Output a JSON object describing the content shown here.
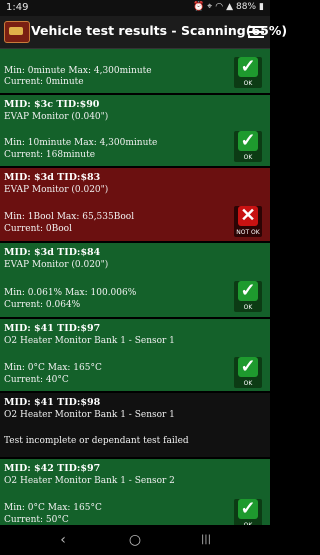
{
  "status": {
    "time": "1:49",
    "battery": "88%"
  },
  "app": {
    "title": "Vehicle test results - Scanning(65%)"
  },
  "results": [
    {
      "status": "ok",
      "status_label": "OK",
      "range": "Min: 0minute  Max: 4,300minute",
      "current": "Current: 0minute"
    },
    {
      "status": "ok",
      "status_label": "OK",
      "mid": "MID: $3c TID:$90",
      "monitor": "EVAP Monitor (0.040\")",
      "range": "Min: 10minute  Max: 4,300minute",
      "current": "Current: 168minute"
    },
    {
      "status": "fail",
      "status_label": "NOT OK",
      "mid": "MID: $3d TID:$83",
      "monitor": "EVAP Monitor (0.020\")",
      "range": "Min: 1Bool  Max: 65,535Bool",
      "current": "Current: 0Bool"
    },
    {
      "status": "ok",
      "status_label": "OK",
      "mid": "MID: $3d TID:$84",
      "monitor": "EVAP Monitor (0.020\")",
      "range": "Min: 0.061%  Max: 100.006%",
      "current": "Current: 0.064%"
    },
    {
      "status": "ok",
      "status_label": "OK",
      "mid": "MID: $41 TID:$97",
      "monitor": "O2 Heater Monitor Bank 1 - Sensor 1",
      "range": "Min: 0°C  Max: 165°C",
      "current": "Current: 40°C"
    },
    {
      "status": "incomplete",
      "mid": "MID: $41 TID:$98",
      "monitor": "O2 Heater Monitor Bank 1 - Sensor 1",
      "message": "Test incomplete or dependant test failed"
    },
    {
      "status": "ok",
      "status_label": "OK",
      "mid": "MID: $42 TID:$97",
      "monitor": "O2 Heater Monitor Bank 1 - Sensor 2",
      "range": "Min: 0°C  Max: 165°C",
      "current": "Current: 50°C"
    }
  ],
  "nav": {
    "back": "‹",
    "home": "○",
    "recents": "|||"
  }
}
